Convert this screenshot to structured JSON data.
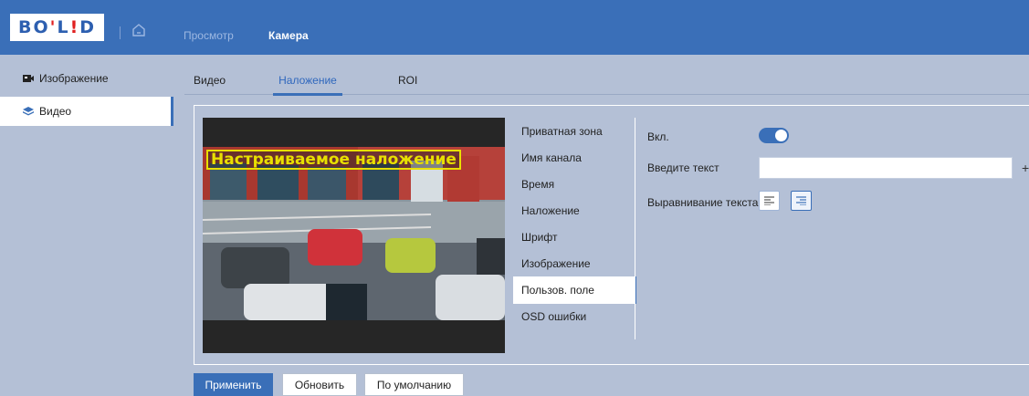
{
  "header": {
    "logo_text_a": "BO",
    "logo_text_b": "L",
    "logo_text_c": "D",
    "nav": [
      {
        "label": "Просмотр"
      },
      {
        "label": "Камера"
      }
    ]
  },
  "sidebar": {
    "items": [
      {
        "label": "Изображение",
        "icon": "camera-icon"
      },
      {
        "label": "Видео",
        "icon": "layers-icon"
      }
    ]
  },
  "tabs": [
    {
      "label": "Видео"
    },
    {
      "label": "Наложение"
    },
    {
      "label": "ROI"
    }
  ],
  "preview": {
    "overlay_text": "Настраиваемое наложение"
  },
  "submenu": {
    "items": [
      {
        "label": "Приватная зона"
      },
      {
        "label": "Имя канала"
      },
      {
        "label": "Время"
      },
      {
        "label": "Наложение"
      },
      {
        "label": "Шрифт"
      },
      {
        "label": "Изображение"
      },
      {
        "label": "Пользов. поле"
      },
      {
        "label": "OSD ошибки"
      }
    ],
    "active": "Пользов. поле"
  },
  "settings": {
    "enable_label": "Вкл.",
    "enable_value": true,
    "text_label": "Введите текст",
    "text_value": "",
    "plus_label": "+",
    "align_label": "Выравнивание текста",
    "align_selected": "right"
  },
  "buttons": {
    "apply": "Применить",
    "refresh": "Обновить",
    "default": "По умолчанию"
  },
  "colors": {
    "accent": "#3a6fb8",
    "overlay": "#e8e000",
    "background": "#b4c0d6"
  }
}
